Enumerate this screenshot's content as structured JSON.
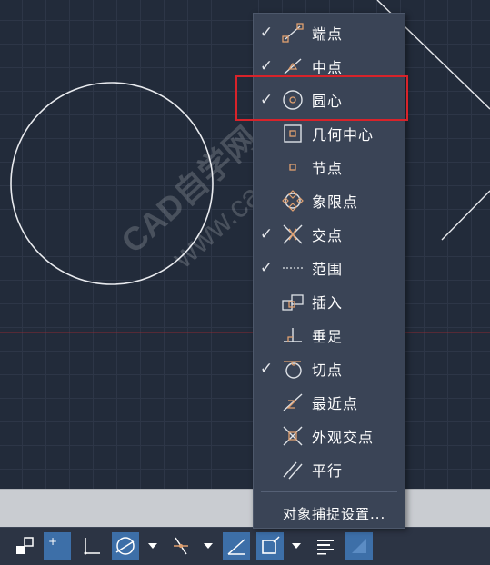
{
  "osnap_menu": {
    "items": [
      {
        "label": "端点",
        "checked": true,
        "icon": "endpoint-icon"
      },
      {
        "label": "中点",
        "checked": true,
        "icon": "midpoint-icon"
      },
      {
        "label": "圆心",
        "checked": true,
        "icon": "center-icon"
      },
      {
        "label": "几何中心",
        "checked": false,
        "icon": "geometric-center-icon"
      },
      {
        "label": "节点",
        "checked": false,
        "icon": "node-icon"
      },
      {
        "label": "象限点",
        "checked": false,
        "icon": "quadrant-icon"
      },
      {
        "label": "交点",
        "checked": true,
        "icon": "intersection-icon"
      },
      {
        "label": "范围",
        "checked": true,
        "icon": "extension-icon"
      },
      {
        "label": "插入",
        "checked": false,
        "icon": "insertion-icon"
      },
      {
        "label": "垂足",
        "checked": false,
        "icon": "perpendicular-icon"
      },
      {
        "label": "切点",
        "checked": true,
        "icon": "tangent-icon"
      },
      {
        "label": "最近点",
        "checked": false,
        "icon": "nearest-icon"
      },
      {
        "label": "外观交点",
        "checked": false,
        "icon": "apparent-intersection-icon"
      },
      {
        "label": "平行",
        "checked": false,
        "icon": "parallel-icon"
      }
    ],
    "settings_label": "对象捕捉设置..."
  },
  "watermark": {
    "line1": "CAD自学网",
    "line2": "www.cadzxw.com"
  },
  "colors": {
    "canvas": "#222b3a",
    "grid": "#2d3647",
    "menu_bg": "#3a4456",
    "highlight": "#d8232a",
    "snap_marker": "#e0a070",
    "active_button": "#3d6fa8"
  },
  "statusbar": {
    "buttons": [
      "snap-grid-icon",
      "grid-snap-icon",
      "ortho-icon",
      "polar-tracking-icon",
      "isometric-icon",
      "osnap-tracking-icon",
      "osnap-icon",
      "lineweight-icon",
      "transparency-icon"
    ]
  }
}
